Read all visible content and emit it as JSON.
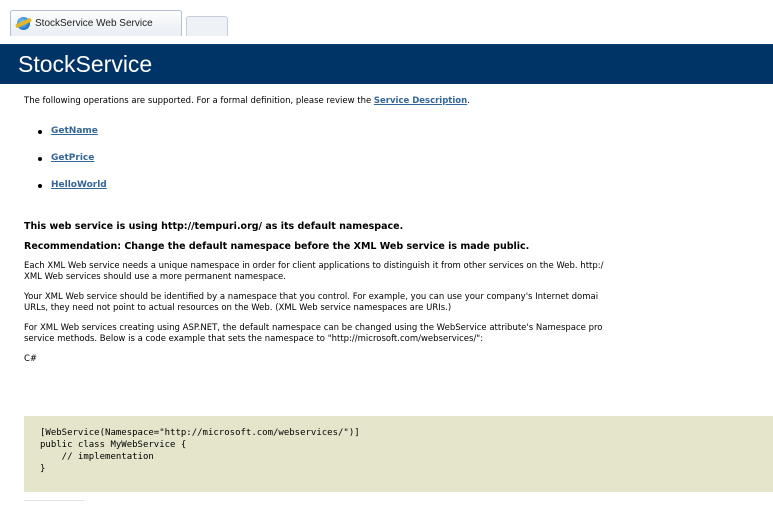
{
  "tab": {
    "title": "StockService Web Service",
    "icon": "ie-globe-icon"
  },
  "banner": {
    "title": "StockService"
  },
  "intro": {
    "text": "The following operations are supported. For a formal definition, please review the ",
    "link": "Service Description",
    "after": "."
  },
  "operations": [
    "GetName",
    "GetPrice",
    "HelloWorld"
  ],
  "namespace_heading": "This web service is using http://tempuri.org/ as its default namespace.",
  "recommendation_heading": "Recommendation: Change the default namespace before the XML Web service is made public.",
  "paragraphs": [
    {
      "line1": "Each XML Web service needs a unique namespace in order for client applications to distinguish it from other services on the Web. http:/",
      "line2": "XML Web services should use a more permanent namespace."
    },
    {
      "line1": "Your XML Web service should be identified by a namespace that you control. For example, you can use your company's Internet domai",
      "line2": "URLs, they need not point to actual resources on the Web. (XML Web service namespaces are URIs.)"
    },
    {
      "line1": "For XML Web services creating using ASP.NET, the default namespace can be changed using the WebService attribute's Namespace pro",
      "line2": "service methods. Below is a code example that sets the namespace to \"http://microsoft.com/webservices/\":"
    }
  ],
  "code_label": "C#",
  "code_lines": [
    "[WebService(Namespace=\"http://microsoft.com/webservices/\")]",
    "public class MyWebService {",
    "    // implementation",
    "}"
  ],
  "colors": {
    "banner": "#003366",
    "link": "#336699",
    "code_bg": "#e5e5cc"
  }
}
